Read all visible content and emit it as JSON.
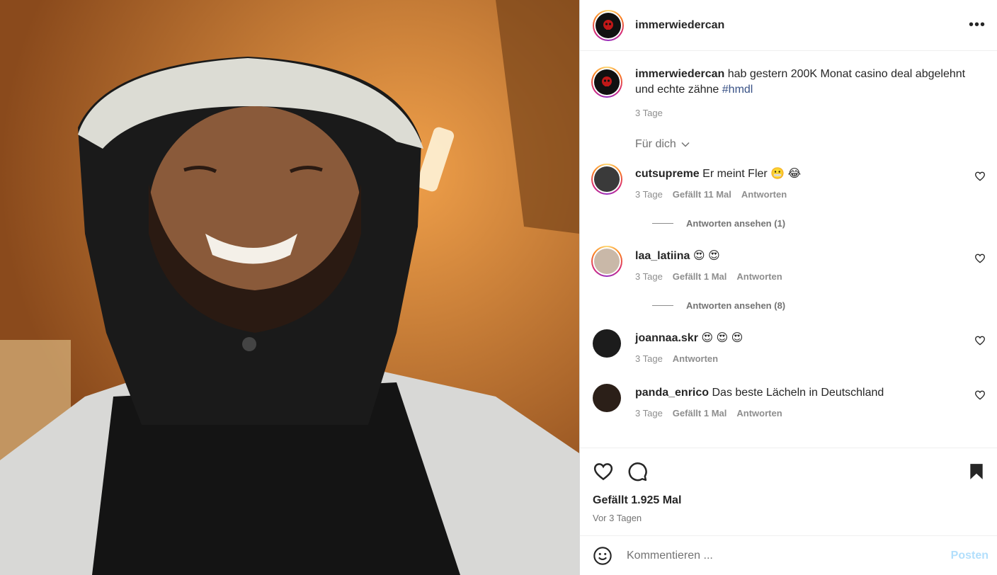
{
  "post": {
    "author": "immerwiedercan",
    "more_icon": "more-horizontal-icon",
    "caption": {
      "username": "immerwiedercan",
      "text": "hab gestern 200K Monat casino deal abgelehnt und echte zähne",
      "hashtag": "#hmdl",
      "time": "3 Tage"
    },
    "sort_label": "Für dich",
    "comments": [
      {
        "username": "cutsupreme",
        "text": "Er meint Fler 😬 😂",
        "time": "3 Tage",
        "likes": "Gefällt 11 Mal",
        "reply": "Antworten",
        "replies": "Antworten ansehen (1)"
      },
      {
        "username": "laa_latiina",
        "text": "😍 😍",
        "time": "3 Tage",
        "likes": "Gefällt 1 Mal",
        "reply": "Antworten",
        "replies": "Antworten ansehen (8)"
      },
      {
        "username": "joannaa.skr",
        "text": "😍 😍 😍",
        "time": "3 Tage",
        "likes": "",
        "reply": "Antworten",
        "replies": ""
      },
      {
        "username": "panda_enrico",
        "text": "Das beste Lächeln in Deutschland",
        "time": "3 Tage",
        "likes": "Gefällt 1 Mal",
        "reply": "Antworten",
        "replies": ""
      }
    ],
    "likes_total": "Gefällt 1.925 Mal",
    "posted_ago": "Vor 3 Tagen",
    "compose": {
      "placeholder": "Kommentieren ...",
      "submit": "Posten"
    }
  },
  "colors": {
    "link": "#385185",
    "muted": "#737373",
    "posten": "#b2dffc"
  }
}
